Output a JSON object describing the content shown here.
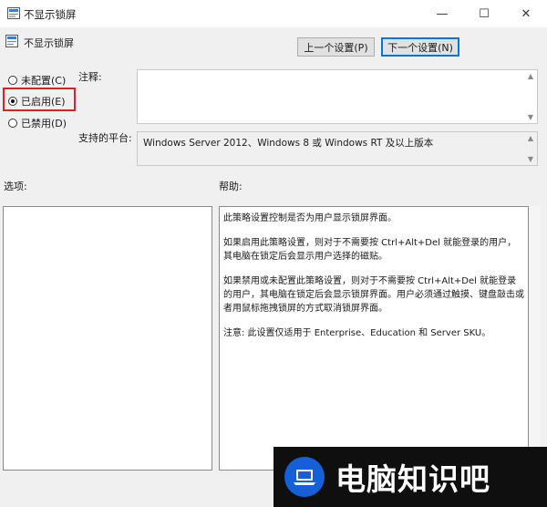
{
  "window": {
    "title": "不显示锁屏",
    "min_glyph": "—",
    "max_glyph": "☐",
    "close_glyph": "✕"
  },
  "policy": {
    "name": "不显示锁屏"
  },
  "nav": {
    "prev_label": "上一个设置(P)",
    "next_label": "下一个设置(N)"
  },
  "state": {
    "options": [
      {
        "label": "未配置(C)",
        "selected": false
      },
      {
        "label": "已启用(E)",
        "selected": true
      },
      {
        "label": "已禁用(D)",
        "selected": false
      }
    ]
  },
  "labels": {
    "comment": "注释:",
    "supported_on": "支持的平台:",
    "options": "选项:",
    "help": "帮助:"
  },
  "supported_on_value": "Windows Server 2012、Windows 8 或 Windows RT 及以上版本",
  "help_text": [
    "此策略设置控制是否为用户显示锁屏界面。",
    "如果启用此策略设置，则对于不需要按 Ctrl+Alt+Del 就能登录的用户，其电脑在锁定后会显示用户选择的磁贴。",
    "如果禁用或未配置此策略设置，则对于不需要按 Ctrl+Alt+Del 就能登录的用户，其电脑在锁定后会显示锁屏界面。用户必须通过触摸、键盘敲击或者用鼠标拖拽锁屏的方式取消锁屏界面。",
    "注意: 此设置仅适用于 Enterprise、Education 和 Server SKU。"
  ],
  "watermark": {
    "text": "电脑知识吧",
    "logo_icon": "laptop-icon"
  },
  "colors": {
    "highlight": "#d8232a",
    "accent": "#0078d7",
    "watermark_logo": "#1560d8"
  }
}
